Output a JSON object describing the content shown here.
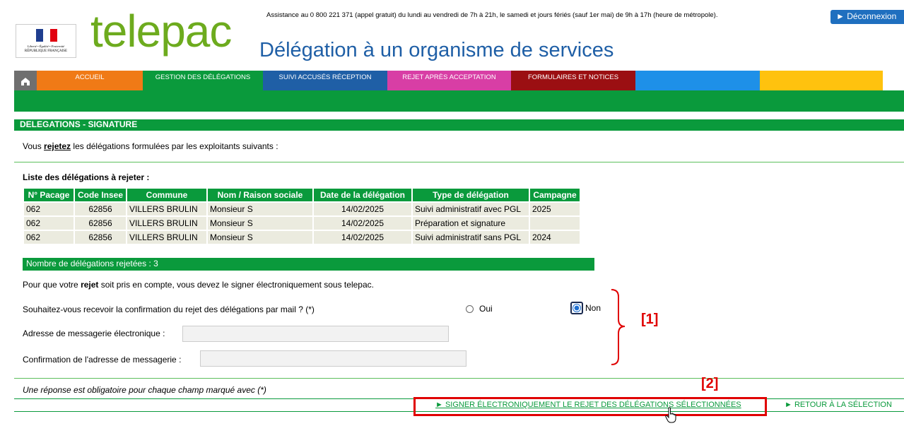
{
  "header": {
    "assistance": "Assistance au 0 800 221 371 (appel gratuit) du lundi au vendredi de 7h à 21h, le samedi et jours fériés (sauf 1er mai) de 9h à 17h (heure de métropole).",
    "logout_label": "► Déconnexion",
    "brand": "telepac",
    "subtitle": "Délégation à un organisme de services",
    "logo_line1": "Liberté • Égalité • Fraternité",
    "logo_line2": "RÉPUBLIQUE FRANÇAISE"
  },
  "nav": {
    "items": [
      {
        "label": "",
        "color": "#6f6f6f"
      },
      {
        "label": "ACCUEIL",
        "color": "#f07a16"
      },
      {
        "label": "GESTION DES DÉLÉGATIONS",
        "color": "#0a9a3c"
      },
      {
        "label": "SUIVI ACCUSÉS RÉCEPTION",
        "color": "#1f5fa6"
      },
      {
        "label": "REJET APRÈS ACCEPTATION",
        "color": "#d83ea5"
      },
      {
        "label": "FORMULAIRES ET NOTICES",
        "color": "#9b0f12"
      },
      {
        "label": "",
        "color": "#1e90e8"
      },
      {
        "label": "",
        "color": "#0a9a3c"
      },
      {
        "label": "",
        "color": "#ffc20e"
      }
    ]
  },
  "section_title": "DELEGATIONS - SIGNATURE",
  "intro": {
    "pre": "Vous ",
    "emph": "rejetez",
    "post": " les délégations formulées par les exploitants suivants :"
  },
  "list_title": "Liste des délégations à rejeter :",
  "table": {
    "headers": [
      "N° Pacage",
      "Code Insee",
      "Commune",
      "Nom / Raison sociale",
      "Date de la délégation",
      "Type de délégation",
      "Campagne"
    ],
    "rows": [
      [
        "062",
        "62856",
        "VILLERS BRULIN",
        "Monsieur S",
        "14/02/2025",
        "Suivi administratif avec PGL",
        "2025"
      ],
      [
        "062",
        "62856",
        "VILLERS BRULIN",
        "Monsieur S",
        "14/02/2025",
        "Préparation et signature",
        ""
      ],
      [
        "062",
        "62856",
        "VILLERS BRULIN",
        "Monsieur S",
        "14/02/2025",
        "Suivi administratif sans PGL",
        "2024"
      ]
    ],
    "count_label": "Nombre de délégations rejetées : 3"
  },
  "rejet_text": {
    "pre": "Pour que votre ",
    "emph": "rejet",
    "post": " soit pris en compte, vous devez le signer électroniquement sous telepac."
  },
  "form": {
    "question": "Souhaitez-vous recevoir la confirmation du rejet des délégations par mail ? (*)",
    "oui_label": "Oui",
    "non_label": "Non",
    "selected": "Non",
    "email_label": "Adresse de messagerie électronique :",
    "email_value": "",
    "email_confirm_label": "Confirmation de l'adresse de messagerie :",
    "email_confirm_value": ""
  },
  "annotations": {
    "a1": "[1]",
    "a2": "[2]"
  },
  "required_note": "Une réponse est obligatoire pour chaque champ marqué avec (*)",
  "actions": {
    "sign_label": "► SIGNER ÉLECTRONIQUEMENT LE REJET DES DÉLÉGATIONS SÉLECTIONNÉES",
    "back_label": "► RETOUR À LA SÉLECTION"
  },
  "colors": {
    "green": "#0a9a3c",
    "annotation_red": "#e00000",
    "blue": "#1f5fa6"
  }
}
